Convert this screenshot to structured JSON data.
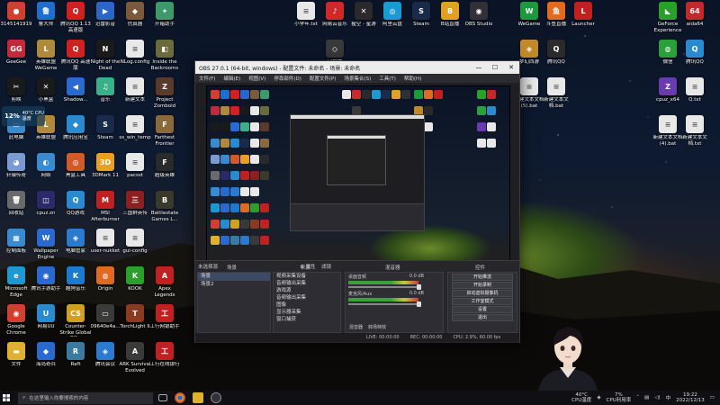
{
  "desktop": {
    "icons": [
      {
        "name": "3145141919",
        "color": "#d04030",
        "glyph": "●",
        "col": 0,
        "row": 0
      },
      {
        "name": "鲁大师",
        "color": "#1e6ed0",
        "glyph": "鲁",
        "col": 1,
        "row": 0
      },
      {
        "name": "腾讯QQ 1.13 高速版",
        "color": "#d02020",
        "glyph": "Q",
        "col": 2,
        "row": 0
      },
      {
        "name": "迅雷影音",
        "color": "#2a66c8",
        "glyph": "▶",
        "col": 3,
        "row": 0
      },
      {
        "name": "仿真器",
        "color": "#7a5a3a",
        "glyph": "◆",
        "col": 4,
        "row": 0
      },
      {
        "name": "开箱助手",
        "color": "#3a9a6a",
        "glyph": "✦",
        "col": 5,
        "row": 0
      },
      {
        "name": "小学年.txt",
        "color": "#e8e8e8",
        "glyph": "≡",
        "col": 8,
        "row": 0
      },
      {
        "name": "网易云音乐",
        "color": "#d02828",
        "glyph": "♪",
        "col": 9,
        "row": 0
      },
      {
        "name": "猩空 - 星游",
        "color": "#2a2a2a",
        "glyph": "✕",
        "col": 10,
        "row": 0
      },
      {
        "name": "阿里云盘",
        "color": "#1a9ad0",
        "glyph": "◎",
        "col": 11,
        "row": 0
      },
      {
        "name": "Steam",
        "color": "#1a2a4a",
        "glyph": "S",
        "col": 12,
        "row": 0
      },
      {
        "name": "B站直播",
        "color": "#e0a020",
        "glyph": "B",
        "col": 13,
        "row": 0
      },
      {
        "name": "OBS Studio",
        "color": "#303036",
        "glyph": "◉",
        "col": 14,
        "row": 0
      },
      {
        "name": "WeGame",
        "color": "#1a9a3a",
        "glyph": "W",
        "col": 16,
        "row": 0
      },
      {
        "name": "斗鱼直播",
        "color": "#e06a20",
        "glyph": "鱼",
        "col": 17,
        "row": 0
      },
      {
        "name": "Launcher",
        "color": "#c02020",
        "glyph": "L",
        "col": 18,
        "row": 0
      },
      {
        "name": "GeForce Experience",
        "color": "#2aa02a",
        "glyph": "◣",
        "col": 20,
        "row": 0
      },
      {
        "name": "aida64",
        "color": "#c02a2a",
        "glyph": "64",
        "col": 21,
        "row": 0
      },
      {
        "name": "GeeGee",
        "color": "#c02a3a",
        "glyph": "GG",
        "col": 0,
        "row": 1
      },
      {
        "name": "英雄联盟 WeGame",
        "color": "#b08a3a",
        "glyph": "L",
        "col": 1,
        "row": 1
      },
      {
        "name": "腾讯QQ 高速版",
        "color": "#d02020",
        "glyph": "Q",
        "col": 2,
        "row": 1
      },
      {
        "name": "Night of the Dead",
        "color": "#1a1a1a",
        "glyph": "N",
        "col": 3,
        "row": 1
      },
      {
        "name": "NLog.config",
        "color": "#e8e8e8",
        "glyph": "≡",
        "col": 4,
        "row": 1
      },
      {
        "name": "Inside the Backrooms",
        "color": "#6a6a3a",
        "glyph": "◧",
        "col": 5,
        "row": 1
      },
      {
        "name": "守护神",
        "color": "#3a3a3a",
        "glyph": "◇",
        "col": 9,
        "row": 1
      },
      {
        "name": "梦幻西游",
        "color": "#c08a2a",
        "glyph": "◈",
        "col": 16,
        "row": 1
      },
      {
        "name": "腾讯QQ",
        "color": "#2a2a2a",
        "glyph": "Q",
        "col": 17,
        "row": 1
      },
      {
        "name": "微信",
        "color": "#2aa03a",
        "glyph": "◍",
        "col": 20,
        "row": 1
      },
      {
        "name": "腾讯QQ",
        "color": "#2a8ad0",
        "glyph": "Q",
        "col": 21,
        "row": 1
      },
      {
        "name": "剪映",
        "color": "#1a1a1a",
        "glyph": "✂",
        "col": 0,
        "row": 2
      },
      {
        "name": "小黑盒",
        "color": "#1a1a1a",
        "glyph": "✕",
        "col": 1,
        "row": 2
      },
      {
        "name": "Shadow...",
        "color": "#2a6ad0",
        "glyph": "◀",
        "col": 2,
        "row": 2
      },
      {
        "name": "音乐",
        "color": "#3ab08a",
        "glyph": "♫",
        "col": 3,
        "row": 2
      },
      {
        "name": "新建文本",
        "color": "#e8e8e8",
        "glyph": "≡",
        "col": 4,
        "row": 2
      },
      {
        "name": "Project Zomboid",
        "color": "#5a3a2a",
        "glyph": "Z",
        "col": 5,
        "row": 2
      },
      {
        "name": "新建文本文档(5).bat",
        "color": "#e8e8e8",
        "glyph": "≡",
        "col": 16,
        "row": 2
      },
      {
        "name": "新建文本文档.bat",
        "color": "#e8e8e8",
        "glyph": "≡",
        "col": 17,
        "row": 2
      },
      {
        "name": "cpuz_x64",
        "color": "#6a3ab0",
        "glyph": "Z",
        "col": 20,
        "row": 2
      },
      {
        "name": "Q.txt",
        "color": "#e8e8e8",
        "glyph": "≡",
        "col": 21,
        "row": 2
      },
      {
        "name": "此电脑",
        "color": "#3a8ad0",
        "glyph": "▭",
        "col": 0,
        "row": 3
      },
      {
        "name": "英雄联盟",
        "color": "#b08a3a",
        "glyph": "L",
        "col": 1,
        "row": 3
      },
      {
        "name": "腾讯应用宝",
        "color": "#2a8ad0",
        "glyph": "◆",
        "col": 2,
        "row": 3
      },
      {
        "name": "Steam",
        "color": "#1a2a4a",
        "glyph": "S",
        "col": 3,
        "row": 3
      },
      {
        "name": "ss_win_temp",
        "color": "#e8e8e8",
        "glyph": "≡",
        "col": 4,
        "row": 3
      },
      {
        "name": "Farthest Frontier",
        "color": "#8a6a3a",
        "glyph": "F",
        "col": 5,
        "row": 3
      },
      {
        "name": "新建文本文档(4).bat",
        "color": "#e8e8e8",
        "glyph": "≡",
        "col": 20,
        "row": 3
      },
      {
        "name": "新建文本文档.txt",
        "color": "#e8e8e8",
        "glyph": "≡",
        "col": 21,
        "row": 3
      },
      {
        "name": "轩辕传奇",
        "color": "#7a9ad0",
        "glyph": "◕",
        "col": 0,
        "row": 4
      },
      {
        "name": "网络",
        "color": "#3a8ad0",
        "glyph": "◐",
        "col": 1,
        "row": 4
      },
      {
        "name": "黑盒工具",
        "color": "#d05a2a",
        "glyph": "◎",
        "col": 2,
        "row": 4
      },
      {
        "name": "3DMark 11",
        "color": "#e8a020",
        "glyph": "3D",
        "col": 3,
        "row": 4
      },
      {
        "name": "pacsst",
        "color": "#e8e8e8",
        "glyph": "≡",
        "col": 4,
        "row": 4
      },
      {
        "name": "超级英雄",
        "color": "#2a2a2a",
        "glyph": "F",
        "col": 5,
        "row": 4
      },
      {
        "name": "回收站",
        "color": "#6a6a6a",
        "glyph": "🗑",
        "col": 0,
        "row": 5
      },
      {
        "name": "cpuz.zn",
        "color": "#2a2a6a",
        "glyph": "◫",
        "col": 1,
        "row": 5
      },
      {
        "name": "QQ游戏",
        "color": "#2a8ad0",
        "glyph": "Q",
        "col": 2,
        "row": 5
      },
      {
        "name": "MSI Afterburner",
        "color": "#c02020",
        "glyph": "M",
        "col": 3,
        "row": 5
      },
      {
        "name": "三国群英传",
        "color": "#8a2020",
        "glyph": "三",
        "col": 4,
        "row": 5
      },
      {
        "name": "Battlestate Games L...",
        "color": "#3a3a2a",
        "glyph": "B",
        "col": 5,
        "row": 5
      },
      {
        "name": "控制面板",
        "color": "#3a8ad0",
        "glyph": "▦",
        "col": 0,
        "row": 6
      },
      {
        "name": "Wallpaper Engine",
        "color": "#2a6ad0",
        "glyph": "W",
        "col": 1,
        "row": 6
      },
      {
        "name": "电脑管家",
        "color": "#2a7ad0",
        "glyph": "◈",
        "col": 2,
        "row": 6
      },
      {
        "name": "user-nukket",
        "color": "#e8e8e8",
        "glyph": "≡",
        "col": 3,
        "row": 6
      },
      {
        "name": "gui-config",
        "color": "#e8e8e8",
        "glyph": "≡",
        "col": 4,
        "row": 6
      },
      {
        "name": "Microsoft Edge",
        "color": "#1a9ad0",
        "glyph": "e",
        "col": 0,
        "row": 7
      },
      {
        "name": "腾讯手游助手",
        "color": "#2a6ad0",
        "glyph": "◉",
        "col": 1,
        "row": 7
      },
      {
        "name": "酷狗音乐",
        "color": "#1a7ad0",
        "glyph": "K",
        "col": 2,
        "row": 7
      },
      {
        "name": "Origin",
        "color": "#e06a20",
        "glyph": "◍",
        "col": 3,
        "row": 7
      },
      {
        "name": "KOOK",
        "color": "#2aa02a",
        "glyph": "K",
        "col": 4,
        "row": 7
      },
      {
        "name": "Apex Legends",
        "color": "#c02020",
        "glyph": "A",
        "col": 5,
        "row": 7
      },
      {
        "name": "Google Chrome",
        "color": "#d04030",
        "glyph": "◉",
        "col": 0,
        "row": 8
      },
      {
        "name": "网易UU",
        "color": "#2a8ad0",
        "glyph": "U",
        "col": 1,
        "row": 8
      },
      {
        "name": "Counter-Strike Global Off...",
        "color": "#d0a020",
        "glyph": "CS",
        "col": 2,
        "row": 8
      },
      {
        "name": "09640e4a...",
        "color": "#3a3a3a",
        "glyph": "▭",
        "col": 3,
        "row": 8
      },
      {
        "name": "TorchLight II",
        "color": "#8a3a20",
        "glyph": "T",
        "col": 4,
        "row": 8
      },
      {
        "name": "工行网银助手",
        "color": "#c02020",
        "glyph": "工",
        "col": 5,
        "row": 8
      },
      {
        "name": "文件",
        "color": "#e0b030",
        "glyph": "▬",
        "col": 0,
        "row": 9
      },
      {
        "name": "海岛奇兵",
        "color": "#2a6ad0",
        "glyph": "◆",
        "col": 1,
        "row": 9
      },
      {
        "name": "Raft",
        "color": "#3a7aa0",
        "glyph": "R",
        "col": 2,
        "row": 9
      },
      {
        "name": "腾讯会议",
        "color": "#2a7ad0",
        "glyph": "◈",
        "col": 3,
        "row": 9
      },
      {
        "name": "ARK Survival Evolved",
        "color": "#3a3a3a",
        "glyph": "A",
        "col": 4,
        "row": 9
      },
      {
        "name": "工行在线银行",
        "color": "#c02020",
        "glyph": "工",
        "col": 5,
        "row": 9
      }
    ],
    "cpu_widget": {
      "percent": "12%",
      "label": "40°C CPU温度"
    }
  },
  "obs": {
    "title": "OBS 27.0.1 (64-bit, windows) - 配置文件: 未命名 - 场景: 未命名",
    "window_buttons": [
      "—",
      "☐",
      "✕"
    ],
    "menu": [
      "文件(F)",
      "编辑(E)",
      "视图(V)",
      "停靠部件(D)",
      "配置文件(P)",
      "场景集合(S)",
      "工具(T)",
      "帮助(H)"
    ],
    "source_bar": {
      "label": "未选择源",
      "properties": "⚙ 属性",
      "filters": "滤镜"
    },
    "scenes": {
      "header": "场景",
      "items": [
        "场景",
        "场景2"
      ],
      "selected": 0
    },
    "sources": {
      "header": "来源",
      "items": [
        "视频采集设备",
        "音频输出采集",
        "游戏源",
        "音频输出采集",
        "图像",
        "显示器采集",
        "窗口捕获"
      ]
    },
    "mixer": {
      "header": "混音器",
      "tracks": [
        {
          "name": "桌面音频",
          "db": "0.0 dB"
        },
        {
          "name": "麦克风/Aux",
          "db": "0.0 dB"
        },
        {
          "name": "音频输出采集",
          "db": "0.0 dB"
        }
      ],
      "tabs": [
        "混音器",
        "转场特效"
      ]
    },
    "controls": {
      "header": "控件",
      "buttons": [
        "开始推流",
        "开始录制",
        "启动虚拟摄像机",
        "工作室模式",
        "设置",
        "退出"
      ]
    },
    "status": {
      "live": "LIVE: 00:00:00",
      "rec": "REC: 00:00:00",
      "cpu": "CPU: 2.9%, 60.00 fps"
    }
  },
  "taskbar": {
    "search_placeholder": "在这里输入你要搜索的内容",
    "cpu_label": "40°C",
    "cpu_sub": "CPU温度",
    "weather": "7%",
    "weather_sub": "CPU利用率",
    "time": "19:22",
    "date": "2022/12/13"
  }
}
